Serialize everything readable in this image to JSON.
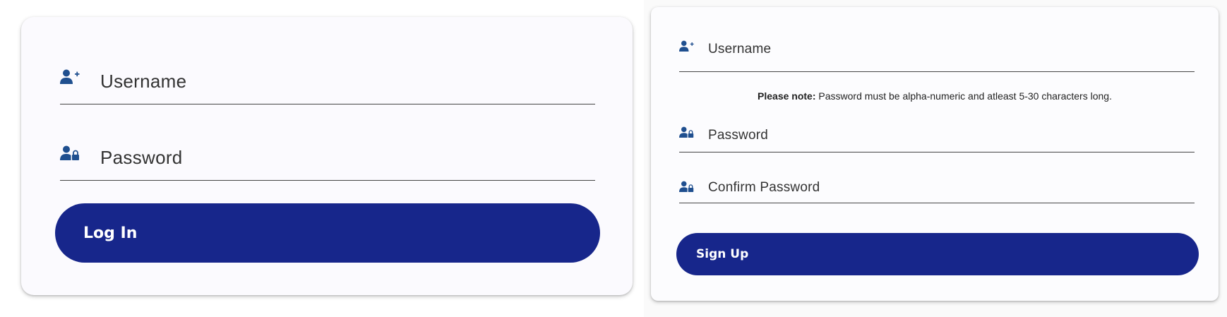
{
  "login": {
    "username_label": "Username",
    "username_icon": "user-plus-icon",
    "password_label": "Password",
    "password_icon": "user-lock-icon",
    "button_label": "Log In"
  },
  "signup": {
    "username_label": "Username",
    "username_icon": "user-plus-icon",
    "note_strong": "Please note:",
    "note_text": " Password must be alpha-numeric and atleast 5-30 characters long.",
    "password_label": "Password",
    "password_icon": "user-lock-icon",
    "confirm_label": "Confirm Password",
    "confirm_icon": "user-lock-icon",
    "button_label": "Sign Up"
  },
  "colors": {
    "button_bg": "#17268b",
    "icon": "#1f4f8f",
    "card_bg": "#fbfafe"
  }
}
